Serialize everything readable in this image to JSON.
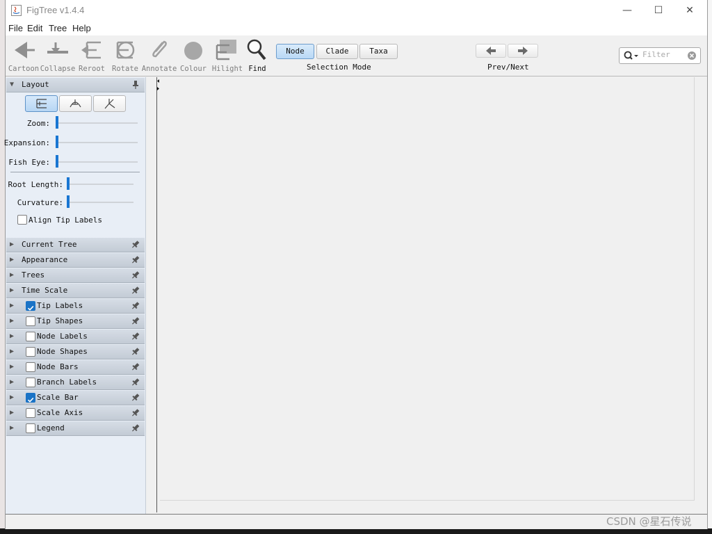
{
  "window": {
    "title": "FigTree v1.4.4",
    "minimize": "—",
    "maximize": "☐",
    "close": "✕"
  },
  "menu": [
    "File",
    "Edit",
    "Tree",
    "Help"
  ],
  "toolbar": {
    "tools": [
      {
        "label": "Cartoon",
        "icon": "cartoon-icon"
      },
      {
        "label": "Collapse",
        "icon": "collapse-icon"
      },
      {
        "label": "Reroot",
        "icon": "reroot-icon"
      },
      {
        "label": "Rotate",
        "icon": "rotate-icon"
      },
      {
        "label": "Annotate",
        "icon": "annotate-icon"
      },
      {
        "label": "Colour",
        "icon": "colour-icon"
      },
      {
        "label": "Hilight",
        "icon": "hilight-icon"
      },
      {
        "label": "Find",
        "icon": "find-icon"
      }
    ],
    "selection_mode": {
      "label": "Selection Mode",
      "options": [
        "Node",
        "Clade",
        "Taxa"
      ],
      "selected": "Node"
    },
    "prev_next": {
      "label": "Prev/Next"
    },
    "filter": {
      "placeholder": "Filter"
    }
  },
  "sidebar": {
    "layout": {
      "title": "Layout",
      "sliders": [
        {
          "label": "Zoom:",
          "value": 0
        },
        {
          "label": "Expansion:",
          "value": 0
        },
        {
          "label": "Fish Eye:",
          "value": 0
        },
        {
          "label": "Root Length:",
          "value": 0
        },
        {
          "label": "Curvature:",
          "value": 0
        }
      ],
      "align_tip_labels": {
        "label": "Align Tip Labels",
        "checked": false
      }
    },
    "panels": [
      {
        "label": "Current Tree"
      },
      {
        "label": "Appearance"
      },
      {
        "label": "Trees"
      },
      {
        "label": "Time Scale"
      },
      {
        "label": "Tip Labels",
        "checked": true
      },
      {
        "label": "Tip Shapes",
        "checked": false
      },
      {
        "label": "Node Labels",
        "checked": false
      },
      {
        "label": "Node Shapes",
        "checked": false
      },
      {
        "label": "Node Bars",
        "checked": false
      },
      {
        "label": "Branch Labels",
        "checked": false
      },
      {
        "label": "Scale Bar",
        "checked": true
      },
      {
        "label": "Scale Axis",
        "checked": false
      },
      {
        "label": "Legend",
        "checked": false
      }
    ]
  },
  "watermark": "CSDN @星石传说",
  "colors": {
    "accent": "#1976d2",
    "selected_button": "#b9d8f5",
    "panel_header": "#c8d0da",
    "sidebar_bg": "#e8eef6"
  }
}
